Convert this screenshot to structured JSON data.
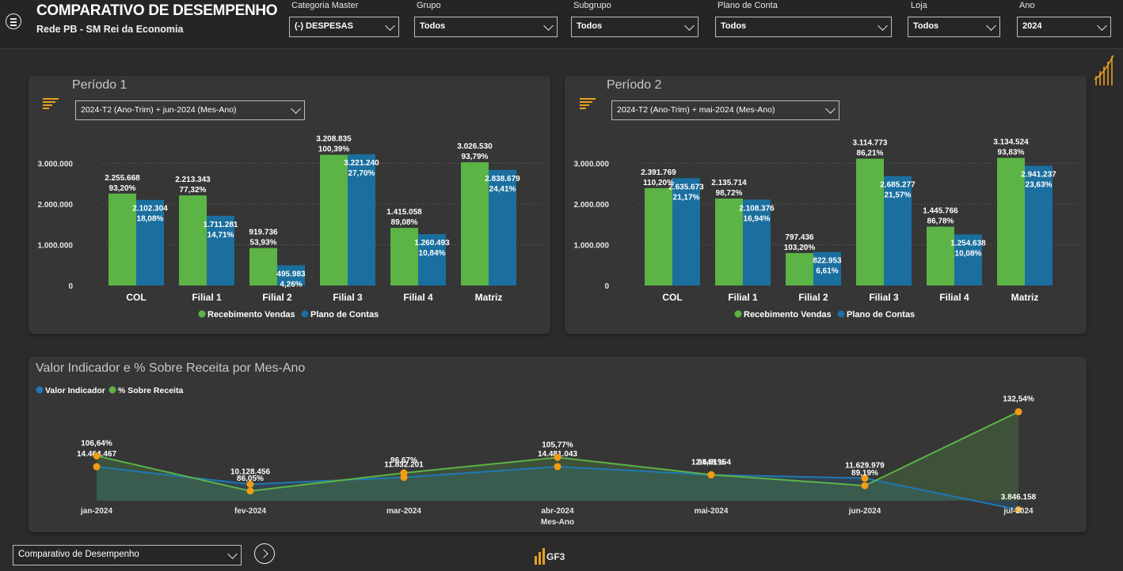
{
  "header": {
    "title": "COMPARATIVO DE DESEMPENHO",
    "subtitle": "Rede PB - SM Rei da Economia"
  },
  "filters": [
    {
      "label": "Categoria Master",
      "value": "(-) DESPESAS"
    },
    {
      "label": "Grupo",
      "value": "Todos"
    },
    {
      "label": "Subgrupo",
      "value": "Todos"
    },
    {
      "label": "Plano de Conta",
      "value": "Todos"
    },
    {
      "label": "Loja",
      "value": "Todos"
    },
    {
      "label": "Ano",
      "value": "2024"
    }
  ],
  "colors": {
    "green": "#5cb346",
    "blue": "#1a6f9f",
    "orange": "#f39c12",
    "line_blue": "#1f78b4",
    "line_green": "#5cb346"
  },
  "panels": [
    {
      "title": "Período 1",
      "dropdown": "2024-T2 (Ano-Trim) + jun-2024 (Mes-Ano)"
    },
    {
      "title": "Período 2",
      "dropdown": "2024-T2 (Ano-Trim) + mai-2024 (Mes-Ano)"
    }
  ],
  "chart_data": [
    {
      "type": "bar",
      "categories": [
        "COL",
        "Filial 1",
        "Filial 2",
        "Filial 3",
        "Filial 4",
        "Matriz"
      ],
      "yticks": [
        "0",
        "1.000.000",
        "2.000.000",
        "3.000.000"
      ],
      "ylim": [
        0,
        3000000
      ],
      "series": [
        {
          "name": "Recebimento Vendas",
          "values": [
            2255668,
            2213343,
            919736,
            3208835,
            1415058,
            3026530
          ],
          "labels": [
            "2.255.668",
            "2.213.343",
            "919.736",
            "3.208.835",
            "1.415.058",
            "3.026.530"
          ],
          "pct": [
            "93,20%",
            "77,32%",
            "53,93%",
            "100,39%",
            "89,08%",
            "93,79%"
          ]
        },
        {
          "name": "Plano de Contas",
          "values": [
            2102304,
            1711281,
            495983,
            3221240,
            1260493,
            2838679
          ],
          "labels": [
            "2.102.304",
            "1.711.281",
            "495.983",
            "3.221.240",
            "1.260.493",
            "2.838.679"
          ],
          "pct": [
            "18,08%",
            "14,71%",
            "4,26%",
            "27,70%",
            "10,84%",
            "24,41%"
          ]
        }
      ],
      "legend": "bottom"
    },
    {
      "type": "bar",
      "categories": [
        "COL",
        "Filial 1",
        "Filial 2",
        "Filial 3",
        "Filial 4",
        "Matriz"
      ],
      "yticks": [
        "0",
        "1.000.000",
        "2.000.000",
        "3.000.000"
      ],
      "ylim": [
        0,
        3000000
      ],
      "series": [
        {
          "name": "Recebimento Vendas",
          "values": [
            2391769,
            2135714,
            797436,
            3114773,
            1445766,
            3134524
          ],
          "labels": [
            "2.391.769",
            "2.135.714",
            "797.436",
            "3.114.773",
            "1.445.766",
            "3.134.524"
          ],
          "pct": [
            "110,20%",
            "98,72%",
            "103,20%",
            "86,21%",
            "86,78%",
            "93,83%"
          ]
        },
        {
          "name": "Plano de Contas",
          "values": [
            2635673,
            2108376,
            822953,
            2685277,
            1254638,
            2941237
          ],
          "labels": [
            "2.635.673",
            "2.108.376",
            "822.953",
            "2.685.277",
            "1.254.638",
            "2.941.237"
          ],
          "pct": [
            "21,17%",
            "16,94%",
            "6,61%",
            "21,57%",
            "10,08%",
            "23,63%"
          ]
        }
      ],
      "legend": "bottom"
    },
    {
      "type": "line",
      "title": "Valor Indicador e % Sobre Receita por Mes-Ano",
      "xlabel": "Mes-Ano",
      "x": [
        "jan-2024",
        "fev-2024",
        "mar-2024",
        "abr-2024",
        "mai-2024",
        "jun-2024",
        "jul-2024"
      ],
      "series": [
        {
          "name": "Valor Indicador",
          "values": [
            14464467,
            10128456,
            11832201,
            14481043,
            12448154,
            11629979,
            3846158
          ],
          "labels": [
            "14.464.467",
            "10.128.456",
            "11.832.201",
            "14.481.043",
            "12.448.154",
            "11.629.979",
            "3.846.158"
          ]
        },
        {
          "name": "% Sobre Receita",
          "values": [
            106.64,
            86.05,
            96.67,
            105.77,
            95.61,
            89.19,
            132.54
          ],
          "labels": [
            "106,64%",
            "86,05%",
            "96,67%",
            "105,77%",
            "95,61%",
            "89,19%",
            "132,54%"
          ]
        }
      ],
      "legend": "top-left"
    }
  ],
  "footer": {
    "page_select": "Comparativo de Desempenho",
    "logo_text": "GF3"
  }
}
